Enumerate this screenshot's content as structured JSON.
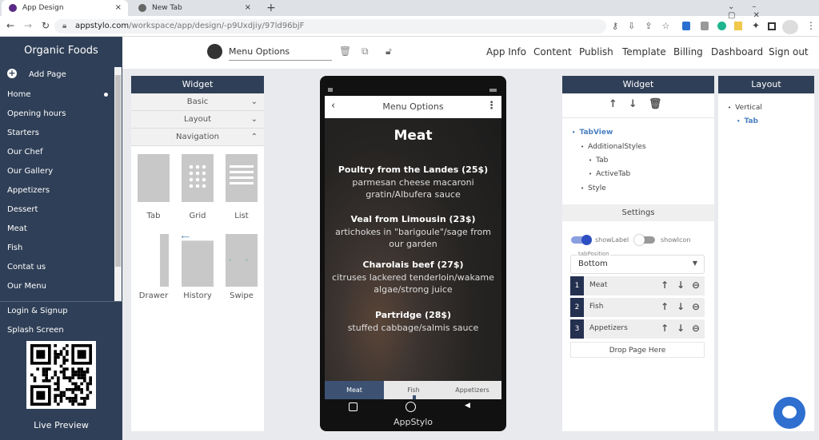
{
  "browser": {
    "tabs": [
      {
        "title": "App Design",
        "close": "×"
      },
      {
        "title": "New Tab",
        "close": "×"
      }
    ],
    "new_tab": "+",
    "url_host": "appstylo.com",
    "url_path": "/workspace/app/design/-p9Uxdjiy/97ld96bjF"
  },
  "sidebar": {
    "app_name": "Organic Foods",
    "add_page": "Add Page",
    "pages": [
      "Home",
      "Opening hours",
      "Starters",
      "Our Chef",
      "Our Gallery",
      "Appetizers",
      "Dessert",
      "Meat",
      "Fish",
      "Contat us",
      "Our Menu"
    ],
    "extra": [
      "Login & Signup",
      "Splash Screen"
    ],
    "live_preview": "Live Preview"
  },
  "header": {
    "page_name": "Menu Options",
    "nav": [
      "App Info",
      "Content",
      "Publish",
      "Template",
      "Billing",
      "Dashboard",
      "Sign out"
    ]
  },
  "widget_panel": {
    "title": "Widget",
    "sections": [
      "Basic",
      "Layout",
      "Navigation"
    ],
    "widgets": [
      "Tab",
      "Grid",
      "List",
      "Drawer",
      "History",
      "Swipe"
    ]
  },
  "phone": {
    "title": "Menu Options",
    "heading": "Meat",
    "items": [
      {
        "name": "Poultry from the Landes (25$)",
        "desc": "parmesan cheese macaroni gratin/Albufera sauce"
      },
      {
        "name": "Veal from Limousin (23$)",
        "desc": "artichokes in \"barigoule\"/sage from our garden"
      },
      {
        "name": "Charolais beef (27$)",
        "desc": "citruses lackered tenderloin/wakame algae/strong juice"
      },
      {
        "name": "Partridge (28$)",
        "desc": "stuffed cabbage/salmis sauce"
      }
    ],
    "tabs": [
      "Meat",
      "Fish",
      "Appetizers"
    ],
    "active_tab": "Meat",
    "brand": "AppStylo"
  },
  "props": {
    "title": "Widget",
    "tree": [
      "TabView",
      "AdditionalStyles",
      "Tab",
      "ActiveTab",
      "Style"
    ],
    "settings": "Settings",
    "show_label": "showLabel",
    "show_label_on": true,
    "show_icon": "showIcon",
    "show_icon_on": false,
    "tab_position_label": "tabPosition",
    "tab_position": "Bottom",
    "rows": [
      {
        "n": "1",
        "label": "Meat"
      },
      {
        "n": "2",
        "label": "Fish"
      },
      {
        "n": "3",
        "label": "Appetizers"
      }
    ],
    "drop": "Drop Page Here"
  },
  "layout": {
    "title": "Layout",
    "tree": [
      "Vertical",
      "Tab"
    ]
  },
  "colors": {
    "sidebar": "#2f3f57",
    "accent": "#2e57c9",
    "link": "#4a7fc1"
  }
}
